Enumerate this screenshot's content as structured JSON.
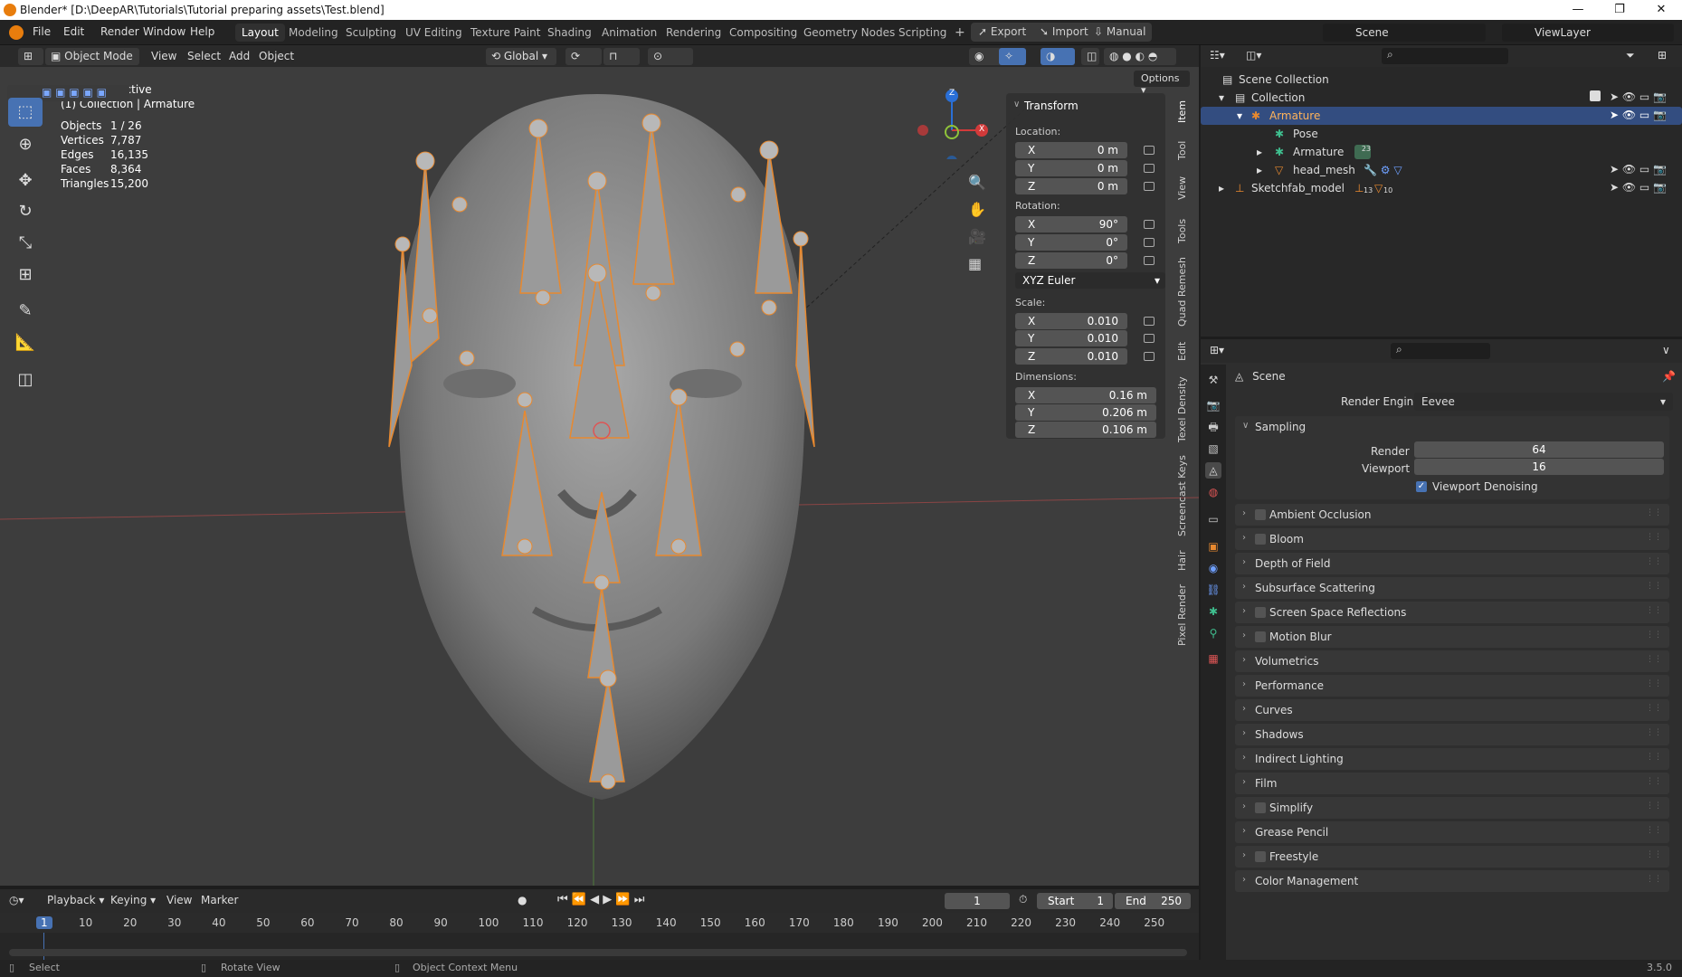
{
  "window": {
    "title": "Blender* [D:\\DeepAR\\Tutorials\\Tutorial preparing assets\\Test.blend]",
    "controls": [
      "—",
      "❐",
      "✕"
    ]
  },
  "menubar": {
    "items": [
      "File",
      "Edit",
      "Render",
      "Window",
      "Help"
    ]
  },
  "workspaces": [
    "Layout",
    "Modeling",
    "Sculpting",
    "UV Editing",
    "Texture Paint",
    "Shading",
    "Animation",
    "Rendering",
    "Compositing",
    "Geometry Nodes",
    "Scripting"
  ],
  "addon_buttons": [
    "Export",
    "Import",
    "Manual"
  ],
  "scene_name": "Scene",
  "view_layer": "ViewLayer",
  "viewport_header": {
    "mode": "Object Mode",
    "menus": [
      "View",
      "Select",
      "Add",
      "Object"
    ],
    "orientation": "Global",
    "options": "Options"
  },
  "overlay": {
    "perspective": "User Perspective",
    "context": "(1) Collection | Armature"
  },
  "stats": [
    {
      "label": "Objects",
      "value": "1 / 26"
    },
    {
      "label": "Vertices",
      "value": "7,787"
    },
    {
      "label": "Edges",
      "value": "16,135"
    },
    {
      "label": "Faces",
      "value": "8,364"
    },
    {
      "label": "Triangles",
      "value": "15,200"
    }
  ],
  "gizmo_axes": [
    "Z",
    "X"
  ],
  "transform": {
    "title": "Transform",
    "location_label": "Location:",
    "location": [
      {
        "axis": "X",
        "value": "0 m"
      },
      {
        "axis": "Y",
        "value": "0 m"
      },
      {
        "axis": "Z",
        "value": "0 m"
      }
    ],
    "rotation_label": "Rotation:",
    "rotation": [
      {
        "axis": "X",
        "value": "90°"
      },
      {
        "axis": "Y",
        "value": "0°"
      },
      {
        "axis": "Z",
        "value": "0°"
      }
    ],
    "rotation_mode": "XYZ Euler",
    "scale_label": "Scale:",
    "scale": [
      {
        "axis": "X",
        "value": "0.010"
      },
      {
        "axis": "Y",
        "value": "0.010"
      },
      {
        "axis": "Z",
        "value": "0.010"
      }
    ],
    "dimensions_label": "Dimensions:",
    "dimensions": [
      {
        "axis": "X",
        "value": "0.16 m"
      },
      {
        "axis": "Y",
        "value": "0.206 m"
      },
      {
        "axis": "Z",
        "value": "0.106 m"
      }
    ]
  },
  "side_tabs": [
    "Item",
    "Tool",
    "View",
    "Tools",
    "Quad Remesh",
    "Edit",
    "Texel Density",
    "Screencast Keys",
    "Hair",
    "Pixel Render"
  ],
  "outliner": {
    "root": "Scene Collection",
    "rows": [
      {
        "label": "Collection",
        "indent": 1
      },
      {
        "label": "Armature",
        "indent": 2
      },
      {
        "label": "Pose",
        "indent": 3
      },
      {
        "label": "Armature",
        "indent": 3,
        "badge": "23"
      },
      {
        "label": "head_mesh",
        "indent": 3
      },
      {
        "label": "Sketchfab_model",
        "indent": 1,
        "badge": "13",
        "badge2": "10"
      }
    ]
  },
  "properties": {
    "context": "Scene",
    "render_engine_label": "Render Engine",
    "render_engine": "Eevee",
    "sampling": {
      "title": "Sampling",
      "render_label": "Render",
      "render_value": "64",
      "viewport_label": "Viewport",
      "viewport_value": "16",
      "denoise_label": "Viewport Denoising"
    },
    "panels": [
      {
        "label": "Ambient Occlusion",
        "checkbox": true
      },
      {
        "label": "Bloom",
        "checkbox": true
      },
      {
        "label": "Depth of Field",
        "checkbox": false
      },
      {
        "label": "Subsurface Scattering",
        "checkbox": false
      },
      {
        "label": "Screen Space Reflections",
        "checkbox": true
      },
      {
        "label": "Motion Blur",
        "checkbox": true
      },
      {
        "label": "Volumetrics",
        "checkbox": false
      },
      {
        "label": "Performance",
        "checkbox": false
      },
      {
        "label": "Curves",
        "checkbox": false
      },
      {
        "label": "Shadows",
        "checkbox": false
      },
      {
        "label": "Indirect Lighting",
        "checkbox": false
      },
      {
        "label": "Film",
        "checkbox": false
      },
      {
        "label": "Simplify",
        "checkbox": true
      },
      {
        "label": "Grease Pencil",
        "checkbox": false
      },
      {
        "label": "Freestyle",
        "checkbox": true
      },
      {
        "label": "Color Management",
        "checkbox": false
      }
    ]
  },
  "timeline": {
    "menus": [
      "Playback",
      "Keying",
      "View",
      "Marker"
    ],
    "current_frame": "1",
    "start_label": "Start",
    "start": "1",
    "end_label": "End",
    "end": "250",
    "ticks": [
      "1",
      "10",
      "20",
      "30",
      "40",
      "50",
      "60",
      "70",
      "80",
      "90",
      "100",
      "110",
      "120",
      "130",
      "140",
      "150",
      "160",
      "170",
      "180",
      "190",
      "200",
      "210",
      "220",
      "230",
      "240",
      "250"
    ]
  },
  "statusbar": {
    "select": "Select",
    "rotate": "Rotate View",
    "context_menu": "Object Context Menu",
    "version": "3.5.0"
  }
}
